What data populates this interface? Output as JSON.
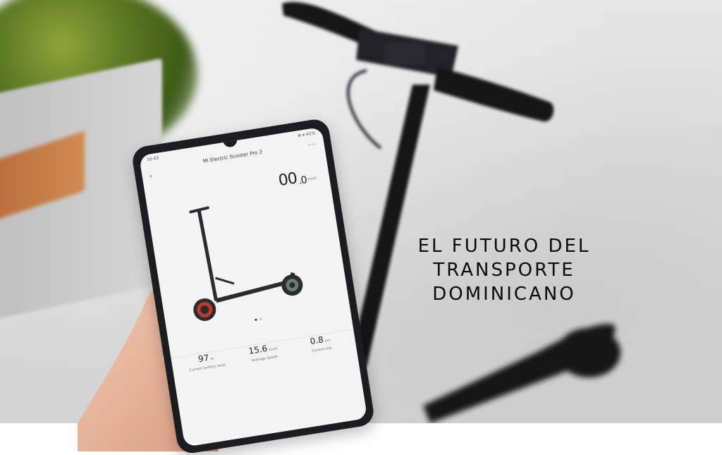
{
  "headline": {
    "line1": "EL FUTURO DEL",
    "line2": "TRANSPORTE",
    "line3": "DOMINICANO"
  },
  "phone": {
    "status_time": "16:43",
    "status_right": "⊕ ▾ 41%",
    "app_title": "Mi Electric Scooter Pro 2",
    "back_icon": "chevron-left-icon",
    "more_icon": "more-icon",
    "speed": {
      "int": "00",
      "dec": ".0",
      "unit": "km/h"
    },
    "stats": [
      {
        "value": "97",
        "unit": "%",
        "label": "Current battery level"
      },
      {
        "value": "15.6",
        "unit": "km/h",
        "label": "Average speed"
      },
      {
        "value": "0.8",
        "unit": "km",
        "label": "Current trip"
      }
    ]
  },
  "colors": {
    "ground": "#dcdcdc",
    "bush": "#5f7b24",
    "bench": "#c07a45",
    "scooter": "#151618",
    "headline": "#0a0a0a"
  }
}
